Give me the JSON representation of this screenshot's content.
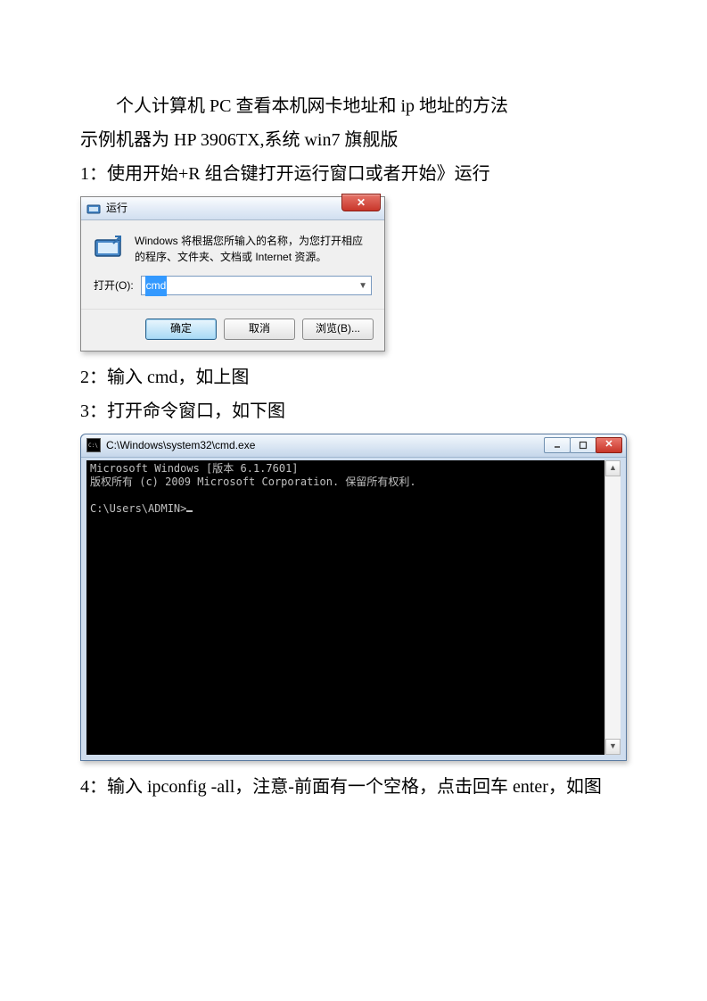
{
  "doc": {
    "title_line": "个人计算机 PC 查看本机网卡地址和 ip 地址的方法",
    "subtitle_line": "示例机器为 HP 3906TX,系统 win7 旗舰版",
    "step1": "1：使用开始+R 组合键打开运行窗口或者开始》运行",
    "step2": "2：输入 cmd，如上图",
    "step3": "3：打开命令窗口，如下图",
    "step4": "4：输入 ipconfig -all，注意-前面有一个空格，点击回车 enter，如图"
  },
  "run_dialog": {
    "title": "运行",
    "description": "Windows 将根据您所输入的名称，为您打开相应的程序、文件夹、文档或 Internet 资源。",
    "open_label": "打开(O):",
    "input_value": "cmd",
    "btn_ok": "确定",
    "btn_cancel": "取消",
    "btn_browse": "浏览(B)...",
    "close_symbol": "✕"
  },
  "cmd_window": {
    "title": "C:\\Windows\\system32\\cmd.exe",
    "line1": "Microsoft Windows [版本 6.1.7601]",
    "line2": "版权所有 (c) 2009 Microsoft Corporation. 保留所有权利.",
    "prompt": "C:\\Users\\ADMIN>",
    "min": "—",
    "close": "✕",
    "scroll_up": "▲",
    "scroll_down": "▼"
  }
}
